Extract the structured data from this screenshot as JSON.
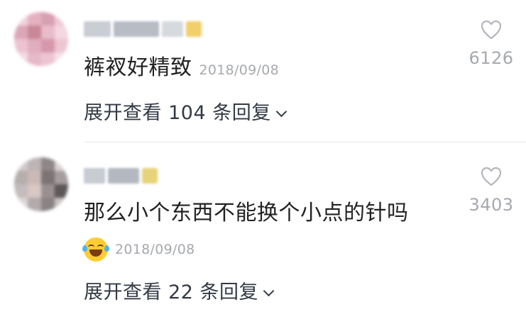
{
  "comments": [
    {
      "text": "裤衩好精致",
      "date": "2018/09/08",
      "like_count": "6126",
      "expand_label": "展开查看 104 条回复",
      "has_emoji": false,
      "emoji_icon": ""
    },
    {
      "text": "那么小个东西不能换个小点的针吗",
      "date": "2018/09/08",
      "like_count": "3403",
      "expand_label": "展开查看 22 条回复",
      "has_emoji": true,
      "emoji_icon": "tears-of-joy-emoji-icon"
    }
  ],
  "colors": {
    "text": "#222222",
    "meta": "#a6a9ae",
    "link": "#333a45",
    "divider": "#e6e7ea"
  }
}
